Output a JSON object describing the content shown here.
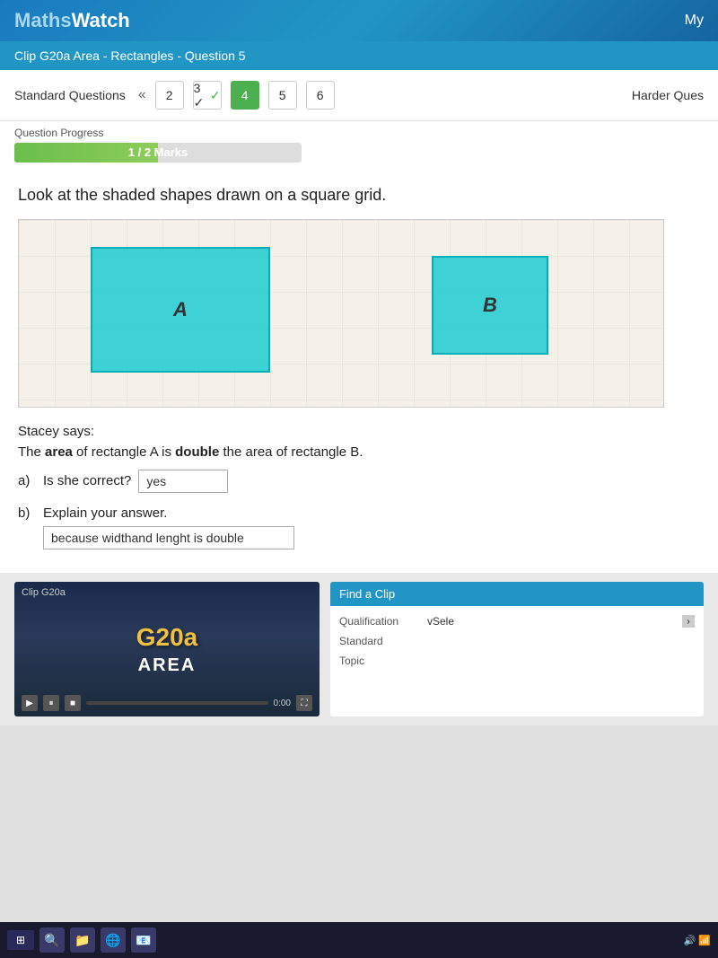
{
  "header": {
    "logo_prefix": "Maths",
    "logo_suffix": "Watch",
    "my_label": "My"
  },
  "breadcrumb": {
    "text": "Clip G20a Area - Rectangles - Question 5"
  },
  "nav": {
    "standard_questions_label": "Standard Questions",
    "chevron": "«",
    "numbers": [
      "2",
      "3",
      "4",
      "5",
      "6"
    ],
    "active_index": 2,
    "checked_index": 1,
    "harder_ques_label": "Harder Ques"
  },
  "progress": {
    "label": "Question Progress",
    "bar_text": "1 / 2 Marks",
    "percent": 50
  },
  "question": {
    "title": "Look at the shaded shapes drawn on a square grid.",
    "rect_a_label": "A",
    "rect_b_label": "B",
    "stacey_line1": "Stacey says:",
    "stacey_line2_pre": "The ",
    "stacey_line2_bold1": "area",
    "stacey_line2_mid": " of rectangle A is ",
    "stacey_line2_bold2": "double",
    "stacey_line2_end": " the area of rectangle B.",
    "part_a_letter": "a)",
    "part_a_question": "Is she correct?",
    "part_a_answer": "yes",
    "part_b_letter": "b)",
    "part_b_question": "Explain your answer.",
    "part_b_answer": "because widthand lenght is double"
  },
  "clip_panel": {
    "label": "Clip G20a",
    "clip_code": "G20a",
    "clip_title": "AREA",
    "find_clip_header": "Find a Clip",
    "qualification_label": "Qualification",
    "qualification_value": "vSele",
    "standard_label": "Standard",
    "topic_label": "Topic"
  },
  "taskbar": {
    "icons": [
      "⊞",
      "🔍",
      "📁",
      "🌐",
      "📧"
    ]
  }
}
